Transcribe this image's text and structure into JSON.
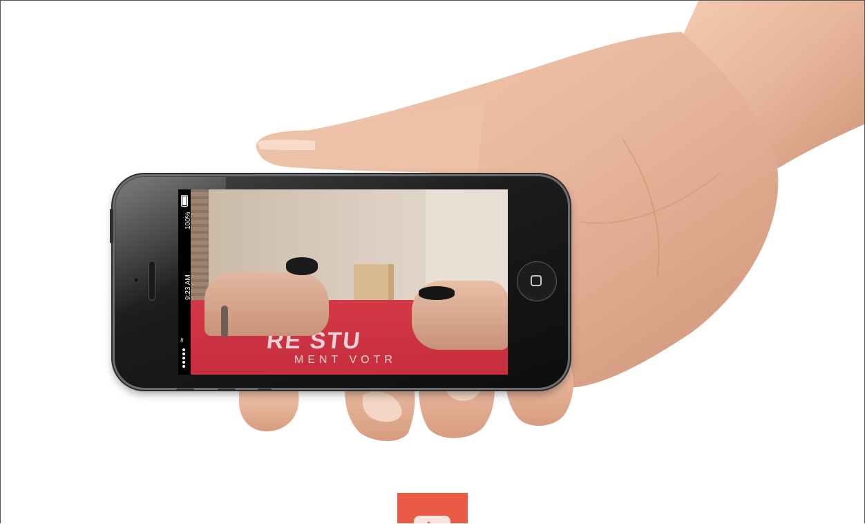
{
  "phone": {
    "status_bar": {
      "battery": "100%",
      "time": "9:23 AM"
    }
  },
  "video_scene": {
    "table_text_main": "RE STU",
    "table_text_sub": "MENT VOTR"
  },
  "colors": {
    "play_tile": "#ea5a45",
    "table_cloth": "#d23846",
    "phone_body": "#1c1c1e"
  },
  "play_button": {
    "icon": "play-icon"
  }
}
